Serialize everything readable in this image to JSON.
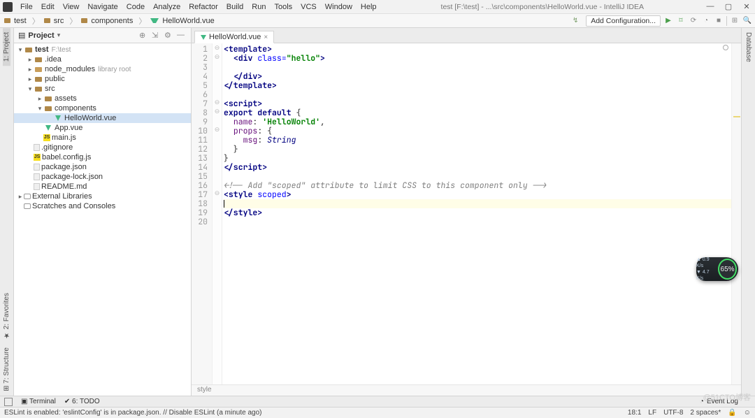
{
  "title": "test [F:\\test] - ...\\src\\components\\HelloWorld.vue - IntelliJ IDEA",
  "menu": [
    "File",
    "Edit",
    "View",
    "Navigate",
    "Code",
    "Analyze",
    "Refactor",
    "Build",
    "Run",
    "Tools",
    "VCS",
    "Window",
    "Help"
  ],
  "breadcrumb": [
    {
      "label": "test",
      "icon": "folder"
    },
    {
      "label": "src",
      "icon": "folder"
    },
    {
      "label": "components",
      "icon": "folder"
    },
    {
      "label": "HelloWorld.vue",
      "icon": "vue"
    }
  ],
  "toolbar": {
    "run_config": "Add Configuration..."
  },
  "left_tools": {
    "project": "1: Project",
    "favorites": "★ 2: Favorites",
    "structure": "⊞ 7: Structure"
  },
  "right_tools": {
    "database": "Database"
  },
  "project_panel": {
    "title": "Project",
    "root": "test",
    "root_hint": "F:\\test",
    "tree": [
      {
        "depth": 0,
        "chev": "▾",
        "icon": "folder",
        "label": "test",
        "hint": "F:\\test",
        "bold": true
      },
      {
        "depth": 1,
        "chev": "▸",
        "icon": "folder",
        "label": ".idea"
      },
      {
        "depth": 1,
        "chev": "▸",
        "icon": "folder lib",
        "label": "node_modules",
        "hint": "library root"
      },
      {
        "depth": 1,
        "chev": "▸",
        "icon": "folder",
        "label": "public"
      },
      {
        "depth": 1,
        "chev": "▾",
        "icon": "folder",
        "label": "src"
      },
      {
        "depth": 2,
        "chev": "▸",
        "icon": "folder",
        "label": "assets"
      },
      {
        "depth": 2,
        "chev": "▾",
        "icon": "folder",
        "label": "components"
      },
      {
        "depth": 3,
        "chev": "",
        "icon": "vue",
        "label": "HelloWorld.vue",
        "selected": true
      },
      {
        "depth": 2,
        "chev": "",
        "icon": "vue",
        "label": "App.vue"
      },
      {
        "depth": 2,
        "chev": "",
        "icon": "js",
        "label": "main.js"
      },
      {
        "depth": 1,
        "chev": "",
        "icon": "json",
        "label": ".gitignore"
      },
      {
        "depth": 1,
        "chev": "",
        "icon": "js",
        "label": "babel.config.js"
      },
      {
        "depth": 1,
        "chev": "",
        "icon": "json",
        "label": "package.json"
      },
      {
        "depth": 1,
        "chev": "",
        "icon": "json",
        "label": "package-lock.json"
      },
      {
        "depth": 1,
        "chev": "",
        "icon": "json",
        "label": "README.md"
      },
      {
        "depth": 0,
        "chev": "▸",
        "icon": "ext",
        "label": "External Libraries"
      },
      {
        "depth": 0,
        "chev": "",
        "icon": "ext",
        "label": "Scratches and Consoles"
      }
    ]
  },
  "tab": {
    "name": "HelloWorld.vue"
  },
  "code_lines": [
    {
      "n": 1,
      "fold": "⊖",
      "html": "<span class=\"tag\">&lt;template&gt;</span>"
    },
    {
      "n": 2,
      "fold": "⊖",
      "html": "  <span class=\"tag\">&lt;div</span> <span class=\"attr\">class=</span><span class=\"str\">\"hello\"</span><span class=\"tag\">&gt;</span>"
    },
    {
      "n": 3,
      "fold": "",
      "html": ""
    },
    {
      "n": 4,
      "fold": "",
      "html": "  <span class=\"tag\">&lt;/div&gt;</span>"
    },
    {
      "n": 5,
      "fold": "",
      "html": "<span class=\"tag\">&lt;/template&gt;</span>"
    },
    {
      "n": 6,
      "fold": "",
      "html": ""
    },
    {
      "n": 7,
      "fold": "⊖",
      "html": "<span class=\"tag\">&lt;script&gt;</span>"
    },
    {
      "n": 8,
      "fold": "⊖",
      "html": "<span class=\"kw\">export default</span> {"
    },
    {
      "n": 9,
      "fold": "",
      "html": "  <span class=\"key\">name</span>: <span class=\"str\">'HelloWorld'</span>,"
    },
    {
      "n": 10,
      "fold": "⊖",
      "html": "  <span class=\"key\">props</span>: {"
    },
    {
      "n": 11,
      "fold": "",
      "html": "    <span class=\"key\">msg</span>: <span class=\"cls\">String</span>"
    },
    {
      "n": 12,
      "fold": "",
      "html": "  }"
    },
    {
      "n": 13,
      "fold": "",
      "html": "}"
    },
    {
      "n": 14,
      "fold": "",
      "html": "<span class=\"tag\">&lt;/script&gt;</span>"
    },
    {
      "n": 15,
      "fold": "",
      "html": ""
    },
    {
      "n": 16,
      "fold": "",
      "html": "<span class=\"cmt\">&lt;!-- Add \"scoped\" attribute to limit CSS to this component only --&gt;</span>"
    },
    {
      "n": 17,
      "fold": "⊖",
      "html": "<span class=\"tag\">&lt;style</span> <span class=\"attr\">scoped</span><span class=\"tag\">&gt;</span>"
    },
    {
      "n": 18,
      "fold": "",
      "hl": true,
      "html": "<span class=\"caret\"></span>"
    },
    {
      "n": 19,
      "fold": "",
      "html": "<span class=\"tag\">&lt;/style&gt;</span>"
    },
    {
      "n": 20,
      "fold": "",
      "html": ""
    }
  ],
  "editor_breadcrumb": "style",
  "bottom_tools": {
    "terminal": "Terminal",
    "todo": "6: TODO",
    "event_log": "Event Log"
  },
  "statusbar": {
    "msg": "ESLint is enabled: 'eslintConfig' is in package.json. // Disable ESLint (a minute ago)",
    "pos": "18:1",
    "lf": "LF",
    "enc": "UTF-8",
    "indent": "2 spaces*"
  },
  "perf": {
    "up": "0.9 K/s",
    "down": "4.7 K/s",
    "pct": "65%"
  },
  "watermark": "@51CTO博客"
}
